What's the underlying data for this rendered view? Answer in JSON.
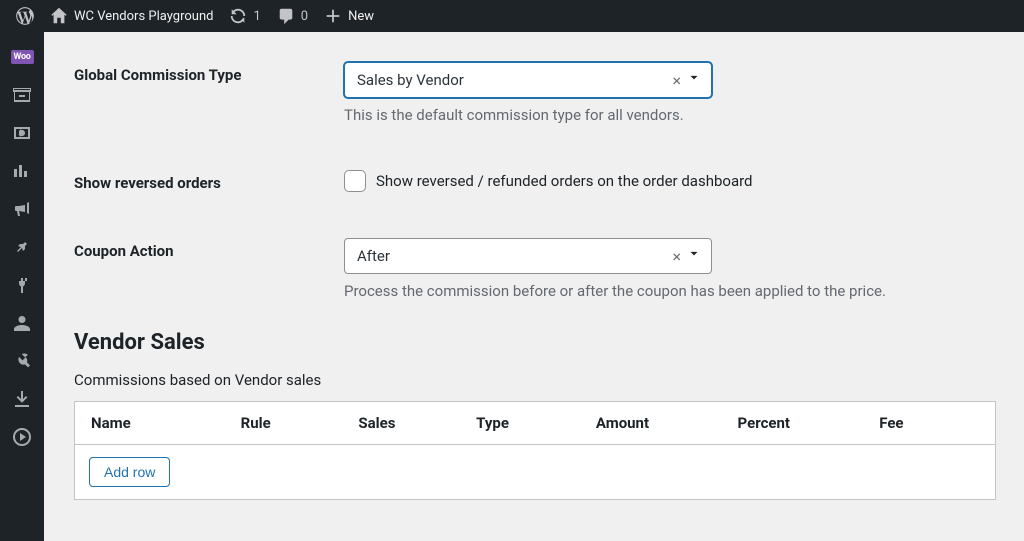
{
  "adminbar": {
    "site_name": "WC Vendors Playground",
    "updates_count": "1",
    "comments_count": "0",
    "new_label": "New"
  },
  "form": {
    "commission_type": {
      "label": "Global Commission Type",
      "value": "Sales by Vendor",
      "desc": "This is the default commission type for all vendors."
    },
    "reversed_orders": {
      "label": "Show reversed orders",
      "checkbox_label": "Show reversed / refunded orders on the order dashboard"
    },
    "coupon_action": {
      "label": "Coupon Action",
      "value": "After",
      "desc": "Process the commission before or after the coupon has been applied to the price."
    }
  },
  "section": {
    "title": "Vendor Sales",
    "desc": "Commissions based on Vendor sales",
    "headers": {
      "name": "Name",
      "rule": "Rule",
      "sales": "Sales",
      "type": "Type",
      "amount": "Amount",
      "percent": "Percent",
      "fee": "Fee"
    },
    "add_row": "Add row"
  }
}
